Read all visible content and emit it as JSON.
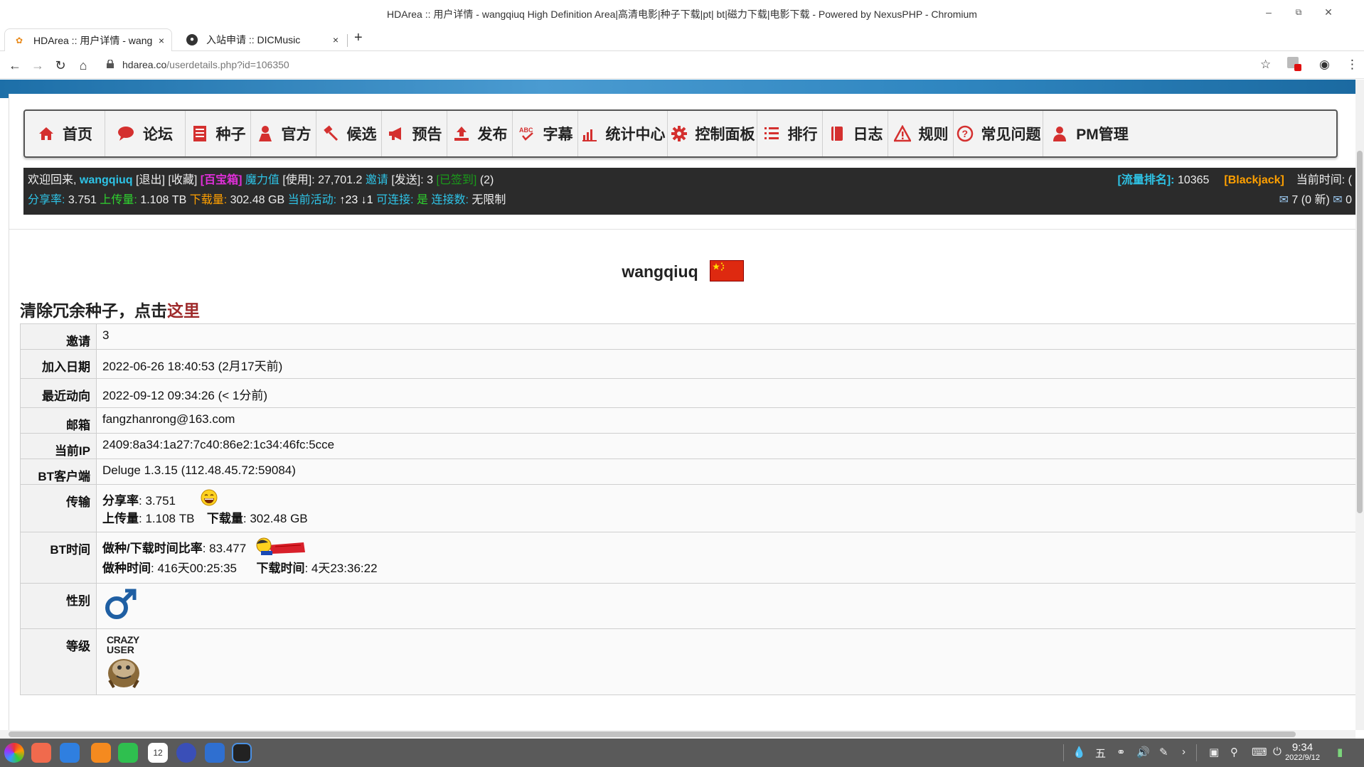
{
  "window": {
    "title": "HDArea :: 用户详情 - wangqiuq High Definition Area|高清电影|种子下载|pt| bt|磁力下载|电影下载 - Powered by NexusPHP - Chromium"
  },
  "tabs": [
    {
      "label": "HDArea :: 用户详情 - wang",
      "close": "×"
    },
    {
      "label": "入站申请 :: DICMusic",
      "close": "×"
    }
  ],
  "newtab": "+",
  "address": {
    "host": "hdarea.co",
    "path": "/userdetails.php?id=106350"
  },
  "menu": [
    {
      "label": "首页",
      "icon": "home-icon",
      "color": "#d4302f"
    },
    {
      "label": "论坛",
      "icon": "chat-icon",
      "color": "#d4302f"
    },
    {
      "label": "种子",
      "icon": "document-icon",
      "color": "#d4302f"
    },
    {
      "label": "官方",
      "icon": "person-icon",
      "color": "#d4302f"
    },
    {
      "label": "候选",
      "icon": "hammer-icon",
      "color": "#d4302f"
    },
    {
      "label": "预告",
      "icon": "megaphone-icon",
      "color": "#d4302f"
    },
    {
      "label": "发布",
      "icon": "upload-icon",
      "color": "#d4302f"
    },
    {
      "label": "字幕",
      "icon": "spellcheck-icon",
      "color": "#d4302f"
    },
    {
      "label": "统计中心",
      "icon": "bar-chart-icon",
      "color": "#d4302f"
    },
    {
      "label": "控制面板",
      "icon": "gear-icon",
      "color": "#d4302f"
    },
    {
      "label": "排行",
      "icon": "list-icon",
      "color": "#d4302f"
    },
    {
      "label": "日志",
      "icon": "book-icon",
      "color": "#d4302f"
    },
    {
      "label": "规则",
      "icon": "warning-icon",
      "color": "#d4302f"
    },
    {
      "label": "常见问题",
      "icon": "question-icon",
      "color": "#d4302f"
    },
    {
      "label": "PM管理",
      "icon": "user-icon",
      "color": "#d4302f"
    }
  ],
  "infobar": {
    "welcome": "欢迎回来,",
    "user": "wangqiuq",
    "logout": "[退出]",
    "favorites": "[收藏]",
    "treasure": "[百宝箱]",
    "magic_label": "魔力值",
    "magic_use": "[使用]: 27,701.2",
    "invite_label": "邀请",
    "invite_send": "[发送]: 3",
    "signed": "[已签到]",
    "signed_count": "(2)",
    "rank_label": "[流量排名]:",
    "rank_value": "10365",
    "blackjack": "[Blackjack]",
    "time_label": "当前时间: (",
    "ratio_label": "分享率:",
    "ratio_value": "3.751",
    "up_label": "上传量:",
    "up_value": "1.108 TB",
    "down_label": "下载量:",
    "down_value": "302.48 GB",
    "active_label": "当前活动:",
    "active_up": "↑23",
    "active_down": "↓1",
    "connectable_label": "可连接:",
    "connectable_value": "是",
    "connections_label": "连接数:",
    "connections_value": "无限制",
    "messages": "7 (0 新)",
    "messages2": "0"
  },
  "profile": {
    "username": "wangqiuq",
    "clean_prefix": "清除冗余种子，点击",
    "clean_link": "这里"
  },
  "details": {
    "invite_k": "邀请",
    "invite_v": "3",
    "join_k": "加入日期",
    "join_v": "2022-06-26 18:40:53 (2月17天前)",
    "last_k": "最近动向",
    "last_v": "2022-09-12 09:34:26 (< 1分前)",
    "email_k": "邮箱",
    "email_v": "fangzhanrong@163.com",
    "ip_k": "当前IP",
    "ip_v": "2409:8a34:1a27:7c40:86e2:1c34:46fc:5cce",
    "client_k": "BT客户端",
    "client_v": "Deluge 1.3.15 (112.48.45.72:59084)",
    "transfer_k": "传输",
    "ratio_l": "分享率",
    "ratio_v": ": 3.751",
    "up_l": "上传量",
    "up_v": ": 1.108 TB",
    "down_l": "下载量",
    "down_v": ": 302.48 GB",
    "bttime_k": "BT时间",
    "seedratio_l": "做种/下载时间比率",
    "seedratio_v": ": 83.477",
    "seedtime_l": "做种时间",
    "seedtime_v": ": 416天00:25:35",
    "dltime_l": "下载时间",
    "dltime_v": ": 4天23:36:22",
    "gender_k": "性别",
    "class_k": "等级",
    "class_text1": "CRAZY",
    "class_text2": "USER"
  },
  "taskbar": {
    "time": "9:34",
    "date": "2022/9/12",
    "ime": "五"
  }
}
